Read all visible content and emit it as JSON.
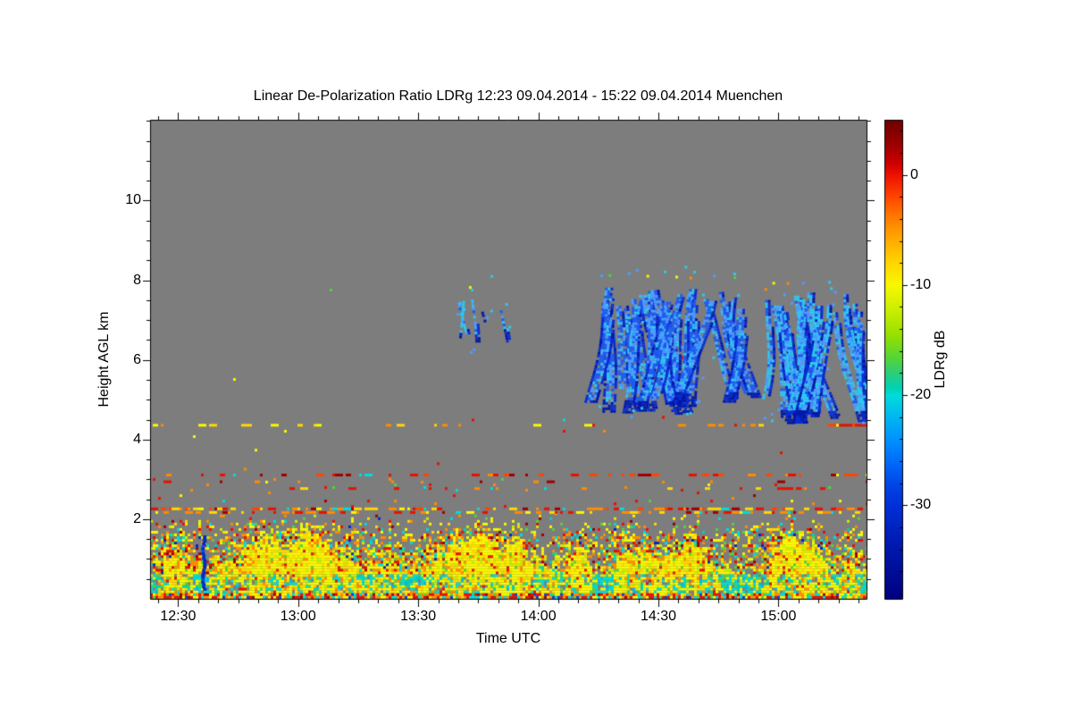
{
  "page": {
    "background": "#ffffff"
  },
  "chart_data": {
    "type": "heatmap",
    "title": "Linear De-Polarization Ratio LDRg   12:23 09.04.2014 - 15:22 09.04.2014 Muenchen",
    "xlabel": "Time UTC",
    "ylabel": "Height AGL km",
    "time_start": "12:23",
    "time_end": "15:22",
    "date": "09.04.2014",
    "station": "Muenchen",
    "t0_min": 743,
    "t1_min": 922,
    "ylim": [
      0,
      12.03
    ],
    "y_minor_step": 0.5,
    "x_minor_step_min": 5,
    "plot_background": "#7d7d7d",
    "frame_color": "#000000",
    "x_ticks": [
      {
        "label": "12:30",
        "min": 750
      },
      {
        "label": "13:00",
        "min": 780
      },
      {
        "label": "13:30",
        "min": 810
      },
      {
        "label": "14:00",
        "min": 840
      },
      {
        "label": "14:30",
        "min": 870
      },
      {
        "label": "15:00",
        "min": 900
      }
    ],
    "y_ticks": [
      {
        "label": "10",
        "km": 10
      },
      {
        "label": "8",
        "km": 8
      },
      {
        "label": "6",
        "km": 6
      },
      {
        "label": "4",
        "km": 4
      },
      {
        "label": "2",
        "km": 2
      }
    ],
    "colorbar": {
      "label": "LDRg dB",
      "vmax": 5,
      "vmin": -38.5,
      "minor_step": 2,
      "ticks": [
        {
          "label": "0",
          "v": 0
        },
        {
          "label": "-10",
          "v": -10
        },
        {
          "label": "-20",
          "v": -20
        },
        {
          "label": "-30",
          "v": -30
        }
      ],
      "stops": [
        [
          0.0,
          "#6f0000"
        ],
        [
          0.05,
          "#9a0000"
        ],
        [
          0.09,
          "#cc0000"
        ],
        [
          0.115,
          "#ee1100"
        ],
        [
          0.16,
          "#ff4400"
        ],
        [
          0.2,
          "#ff7700"
        ],
        [
          0.25,
          "#ffaa00"
        ],
        [
          0.3,
          "#ffd700"
        ],
        [
          0.345,
          "#f8f800"
        ],
        [
          0.4,
          "#c8ee00"
        ],
        [
          0.45,
          "#96e000"
        ],
        [
          0.5,
          "#52d43c"
        ],
        [
          0.53,
          "#2ccd7d"
        ],
        [
          0.56,
          "#00d2b4"
        ],
        [
          0.575,
          "#00dcdc"
        ],
        [
          0.62,
          "#00b8f0"
        ],
        [
          0.67,
          "#0090ff"
        ],
        [
          0.72,
          "#0066f8"
        ],
        [
          0.77,
          "#0040e4"
        ],
        [
          0.805,
          "#0030d8"
        ],
        [
          0.87,
          "#001eb8"
        ],
        [
          1.0,
          "#000080"
        ]
      ]
    },
    "seed": 20140409,
    "field": {
      "cell": 3,
      "h_top": 2.6,
      "ground_h": 0.13,
      "band": {
        "h0": 0.13,
        "h1": 0.6
      },
      "plumes": 30,
      "plume_list": [
        {
          "t": 782,
          "w": 18,
          "top": 2.1
        },
        {
          "t": 835,
          "w": 14,
          "top": 1.9
        },
        {
          "t": 862,
          "w": 20,
          "top": 2.05
        },
        {
          "t": 900,
          "w": 16,
          "top": 2.2
        }
      ],
      "palettes": {
        "ground": [
          [
            "#e81000",
            22
          ],
          [
            "#ff8c00",
            22
          ],
          [
            "#f8f800",
            18
          ],
          [
            "#00dcdc",
            14
          ],
          [
            "#a00000",
            8
          ],
          [
            "#52d43c",
            6
          ],
          [
            "#0040e4",
            5
          ],
          [
            "#ffd700",
            5
          ]
        ],
        "band": [
          [
            "#00dcdc",
            38
          ],
          [
            "#00d2b4",
            16
          ],
          [
            "#52d43c",
            10
          ],
          [
            "#c8ee00",
            10
          ],
          [
            "#f8f800",
            16
          ],
          [
            "#00b8f0",
            6
          ],
          [
            "#ffd700",
            4
          ]
        ],
        "mix": [
          [
            "#f8f800",
            26
          ],
          [
            "#ffd700",
            12
          ],
          [
            "#ff8c00",
            16
          ],
          [
            "#e81000",
            12
          ],
          [
            "#a00000",
            5
          ],
          [
            "#c8ee00",
            8
          ],
          [
            "#52d43c",
            7
          ],
          [
            "#00dcdc",
            10
          ],
          [
            "#00d2b4",
            2
          ],
          [
            "#0028c8",
            2
          ]
        ],
        "dense": [
          [
            "#f8f800",
            46
          ],
          [
            "#ffd700",
            22
          ],
          [
            "#c8ee00",
            12
          ],
          [
            "#ff8c00",
            12
          ],
          [
            "#e81000",
            4
          ],
          [
            "#52d43c",
            4
          ]
        ]
      }
    },
    "stripes": [
      {
        "h": 4.37,
        "density": 0.1,
        "palette": [
          [
            "#f8f800",
            45
          ],
          [
            "#ffd700",
            25
          ],
          [
            "#ff8c00",
            20
          ],
          [
            "#e81000",
            10
          ]
        ],
        "dense_seg": {
          "t0": 912,
          "t1": 922,
          "density": 0.8,
          "palette": [
            [
              "#ff8c00",
              40
            ],
            [
              "#ff4400",
              25
            ],
            [
              "#e81000",
              15
            ],
            [
              "#f8f800",
              20
            ]
          ]
        }
      },
      {
        "h": 3.12,
        "density": 0.15,
        "palette": [
          [
            "#e81000",
            35
          ],
          [
            "#ff4400",
            20
          ],
          [
            "#ff8c00",
            18
          ],
          [
            "#a00000",
            15
          ],
          [
            "#f8f800",
            7
          ],
          [
            "#00dcdc",
            5
          ]
        ]
      },
      {
        "h": 2.95,
        "density": 0.05,
        "palette": [
          [
            "#e81000",
            40
          ],
          [
            "#ff8c00",
            30
          ],
          [
            "#a00000",
            30
          ]
        ]
      },
      {
        "h": 2.78,
        "density": 0.08,
        "palette": [
          [
            "#ff8c00",
            40
          ],
          [
            "#e81000",
            30
          ],
          [
            "#ffd700",
            20
          ],
          [
            "#00dcdc",
            10
          ]
        ]
      },
      {
        "h": 2.27,
        "density": 0.5,
        "palette": [
          [
            "#ff8c00",
            26
          ],
          [
            "#ff4400",
            18
          ],
          [
            "#e81000",
            16
          ],
          [
            "#ffd700",
            16
          ],
          [
            "#f8f800",
            10
          ],
          [
            "#00dcdc",
            8
          ],
          [
            "#a00000",
            6
          ]
        ]
      },
      {
        "h": 2.18,
        "density": 0.3,
        "palette": [
          [
            "#ff8c00",
            24
          ],
          [
            "#e81000",
            20
          ],
          [
            "#ffd700",
            18
          ],
          [
            "#f8f800",
            18
          ],
          [
            "#00dcdc",
            10
          ],
          [
            "#a00000",
            10
          ]
        ]
      }
    ],
    "scatters": [
      {
        "h0": 2.33,
        "h1": 3.05,
        "density": 0.018,
        "palette": [
          [
            "#e81000",
            30
          ],
          [
            "#ff8c00",
            25
          ],
          [
            "#f8f800",
            15
          ],
          [
            "#00dcdc",
            12
          ],
          [
            "#52d43c",
            10
          ],
          [
            "#a00000",
            8
          ]
        ]
      },
      {
        "h0": 3.2,
        "h1": 4.25,
        "density": 0.0012,
        "palette": [
          [
            "#ff8c00",
            40
          ],
          [
            "#f8f800",
            30
          ],
          [
            "#e81000",
            30
          ]
        ]
      },
      {
        "h0": 4.5,
        "h1": 7.9,
        "density": 0.0006,
        "palette": [
          [
            "#e81000",
            25
          ],
          [
            "#f8f800",
            25
          ],
          [
            "#52d43c",
            25
          ],
          [
            "#00dcdc",
            25
          ]
        ]
      }
    ],
    "vstreaks": [
      {
        "t": 756,
        "h0": 0.25,
        "h1": 1.6,
        "w": 4,
        "color": "#0028c8"
      }
    ],
    "cloud_colors": {
      "deep": "#0a2cd0",
      "main": "#1e5af0",
      "light": "#4f9cff",
      "cyan": "#2fc8f0",
      "navy": "#0018a8"
    },
    "clouds": [
      {
        "t0": 820,
        "t1": 824,
        "top": 7.75,
        "bot": 6.35,
        "streaks": 3,
        "wmin": 2,
        "wmax": 4,
        "cyan": 0.5,
        "fringe": 6,
        "warmtop": 1
      },
      {
        "t0": 826,
        "t1": 827.5,
        "top": 7.7,
        "bot": 6.9,
        "streaks": 1,
        "wmin": 3,
        "wmax": 4,
        "cyan": 0.15,
        "fringe": 3,
        "warmtop": 0
      },
      {
        "t0": 831,
        "t1": 832.5,
        "top": 7.65,
        "bot": 6.45,
        "streaks": 1,
        "wmin": 3,
        "wmax": 4,
        "cyan": 0.15,
        "fringe": 3,
        "warmtop": 0
      },
      {
        "t0": 856,
        "t1": 877,
        "top": 7.9,
        "bot": 4.65,
        "streaks": 13,
        "wmin": 6,
        "wmax": 16,
        "cyan": 0.18,
        "fringe": 26,
        "warmtop": 3
      },
      {
        "t0": 877,
        "t1": 891,
        "top": 7.8,
        "bot": 4.85,
        "streaks": 8,
        "wmin": 6,
        "wmax": 14,
        "cyan": 0.2,
        "fringe": 16,
        "warmtop": 2
      },
      {
        "t0": 896,
        "t1": 922,
        "top": 7.7,
        "bot": 4.4,
        "streaks": 15,
        "wmin": 6,
        "wmax": 14,
        "cyan": 0.42,
        "fringe": 28,
        "warmtop": 3
      }
    ]
  }
}
